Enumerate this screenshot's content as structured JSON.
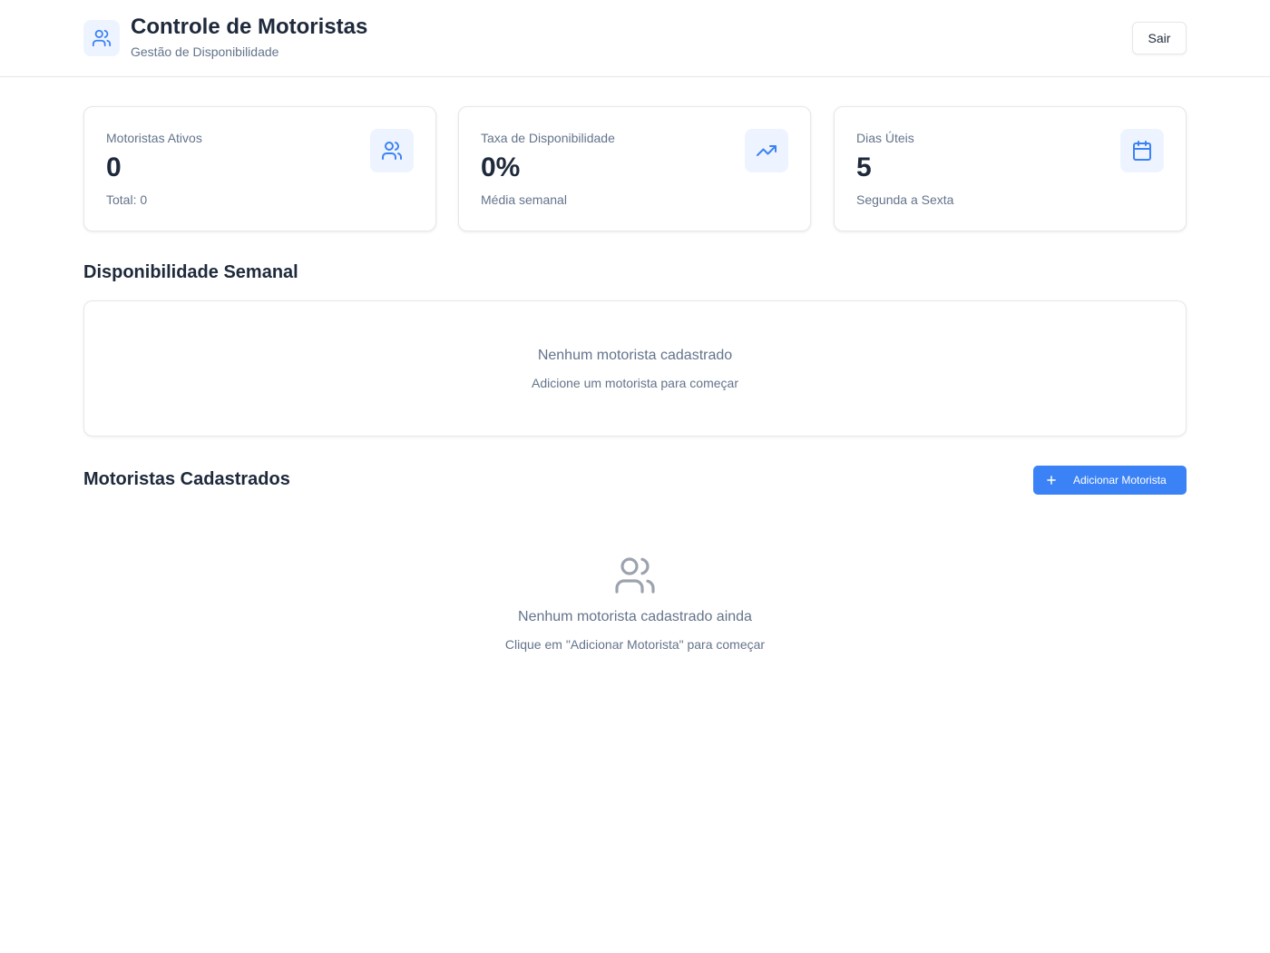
{
  "header": {
    "title": "Controle de Motoristas",
    "subtitle": "Gestão de Disponibilidade",
    "logout_label": "Sair",
    "brand_icon": "users-icon"
  },
  "stats": [
    {
      "label": "Motoristas Ativos",
      "value": "0",
      "note": "Total: 0",
      "icon": "users-icon"
    },
    {
      "label": "Taxa de Disponibilidade",
      "value": "0%",
      "note": "Média semanal",
      "icon": "trending-up-icon"
    },
    {
      "label": "Dias Úteis",
      "value": "5",
      "note": "Segunda a Sexta",
      "icon": "calendar-icon"
    }
  ],
  "weekly": {
    "title": "Disponibilidade Semanal",
    "empty_title": "Nenhum motorista cadastrado",
    "empty_subtitle": "Adicione um motorista para começar"
  },
  "drivers": {
    "title": "Motoristas Cadastrados",
    "add_label": "Adicionar Motorista",
    "empty_title": "Nenhum motorista cadastrado ainda",
    "empty_subtitle": "Clique em \"Adicionar Motorista\" para começar",
    "empty_icon": "users-icon"
  },
  "colors": {
    "accent": "#3b82f6",
    "icon_bg": "#eef4ff",
    "muted_text": "#64748b",
    "heading_text": "#1e293b",
    "border": "#e5e7eb"
  }
}
